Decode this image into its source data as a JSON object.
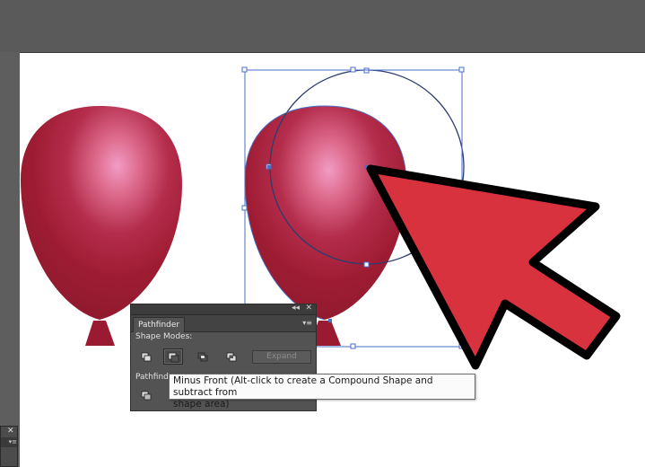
{
  "pathfinder_panel": {
    "tab_title": "Pathfinder",
    "collapse_glyph": "◂◂",
    "close_glyph": "✕",
    "menu_glyph": "▾≡",
    "shape_modes_label": "Shape Modes:",
    "expand_label": "Expand",
    "pathfinders_label": "Pathfinde",
    "shape_mode_icons": [
      "unite-icon",
      "minus-front-icon",
      "intersect-icon",
      "exclude-icon"
    ]
  },
  "tooltip": {
    "line1": "Minus Front (Alt-click to create a Compound Shape and subtract from",
    "line2": "shape area)"
  },
  "mini_panel": {
    "close_glyph": "✕",
    "menu_glyph": "▾≡"
  },
  "colors": {
    "balloon": "#9e1c33",
    "balloon_highlight": "#ef9bc1",
    "selection": "#4a6fc4",
    "cursor_fill": "#d9323f",
    "cursor_outline": "#000000"
  }
}
